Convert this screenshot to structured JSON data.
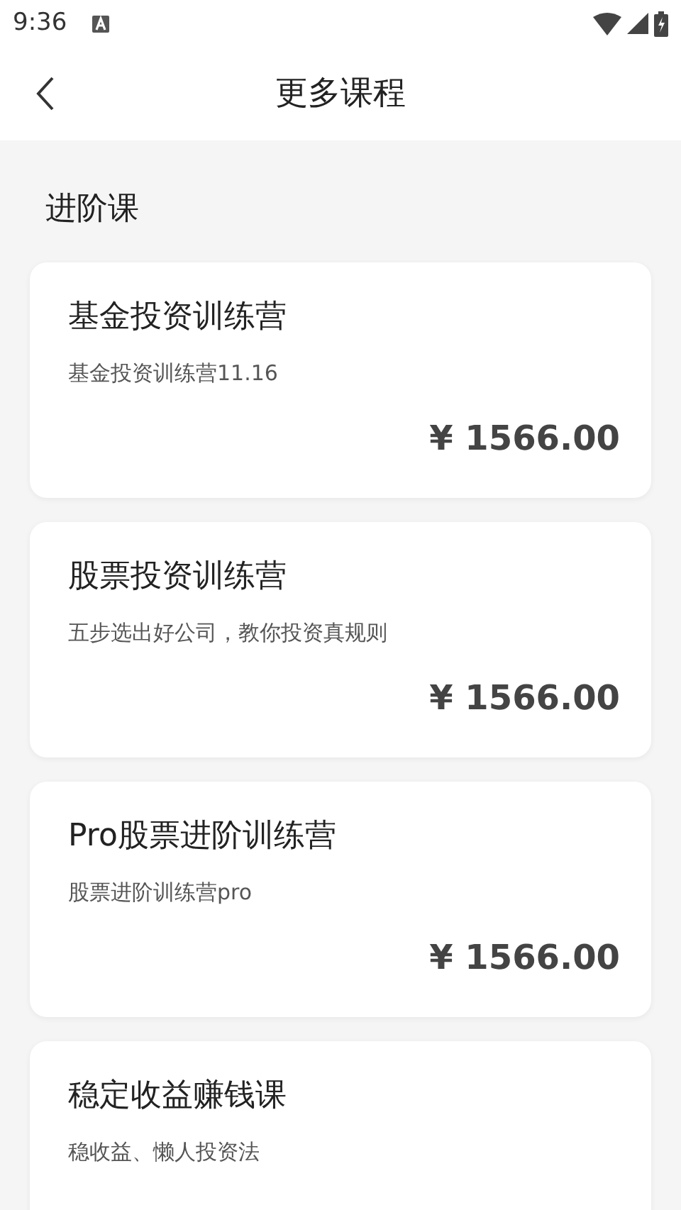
{
  "status_bar": {
    "time": "9:36"
  },
  "header": {
    "title": "更多课程"
  },
  "section": {
    "title": "进阶课"
  },
  "courses": [
    {
      "title": "基金投资训练营",
      "subtitle": "基金投资训练营11.16",
      "price": "¥ 1566.00"
    },
    {
      "title": "股票投资训练营",
      "subtitle": "五步选出好公司，教你投资真规则",
      "price": "¥ 1566.00"
    },
    {
      "title": "Pro股票进阶训练营",
      "subtitle": "股票进阶训练营pro",
      "price": "¥ 1566.00"
    },
    {
      "title": "稳定收益赚钱课",
      "subtitle": "稳收益、懒人投资法"
    }
  ]
}
